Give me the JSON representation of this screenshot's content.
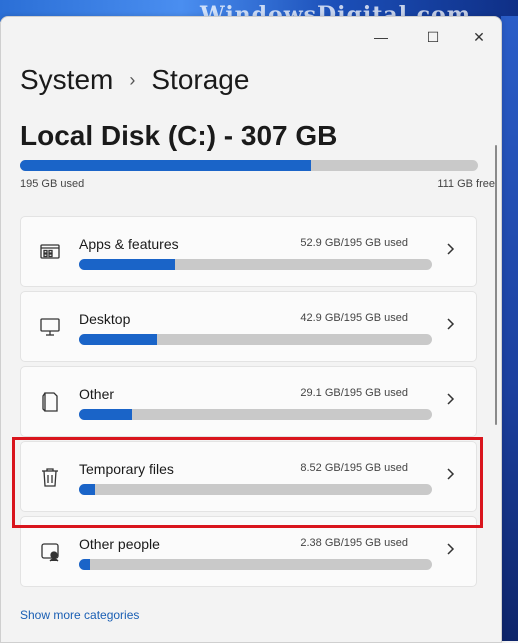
{
  "watermark": "WindowsDigital.com",
  "window": {
    "minimize": "—",
    "maximize": "☐",
    "close": "✕"
  },
  "breadcrumb": {
    "root": "System",
    "separator": "›",
    "current": "Storage"
  },
  "disk": {
    "title": "Local Disk (C:) - 307 GB",
    "used_label": "195 GB used",
    "free_label": "111 GB free",
    "used_fraction": 0.635
  },
  "categories": [
    {
      "name": "Apps & features",
      "usage": "52.9 GB/195 GB used",
      "fraction": 0.271,
      "icon": "apps-icon"
    },
    {
      "name": "Desktop",
      "usage": "42.9 GB/195 GB used",
      "fraction": 0.22,
      "icon": "monitor-icon"
    },
    {
      "name": "Other",
      "usage": "29.1 GB/195 GB used",
      "fraction": 0.149,
      "icon": "document-icon"
    },
    {
      "name": "Temporary files",
      "usage": "8.52 GB/195 GB used",
      "fraction": 0.044,
      "icon": "trash-icon"
    },
    {
      "name": "Other people",
      "usage": "2.38 GB/195 GB used",
      "fraction": 0.012,
      "icon": "people-icon"
    }
  ],
  "show_more": "Show more categories",
  "colors": {
    "accent": "#1a64c8",
    "highlight": "#d9151d"
  }
}
